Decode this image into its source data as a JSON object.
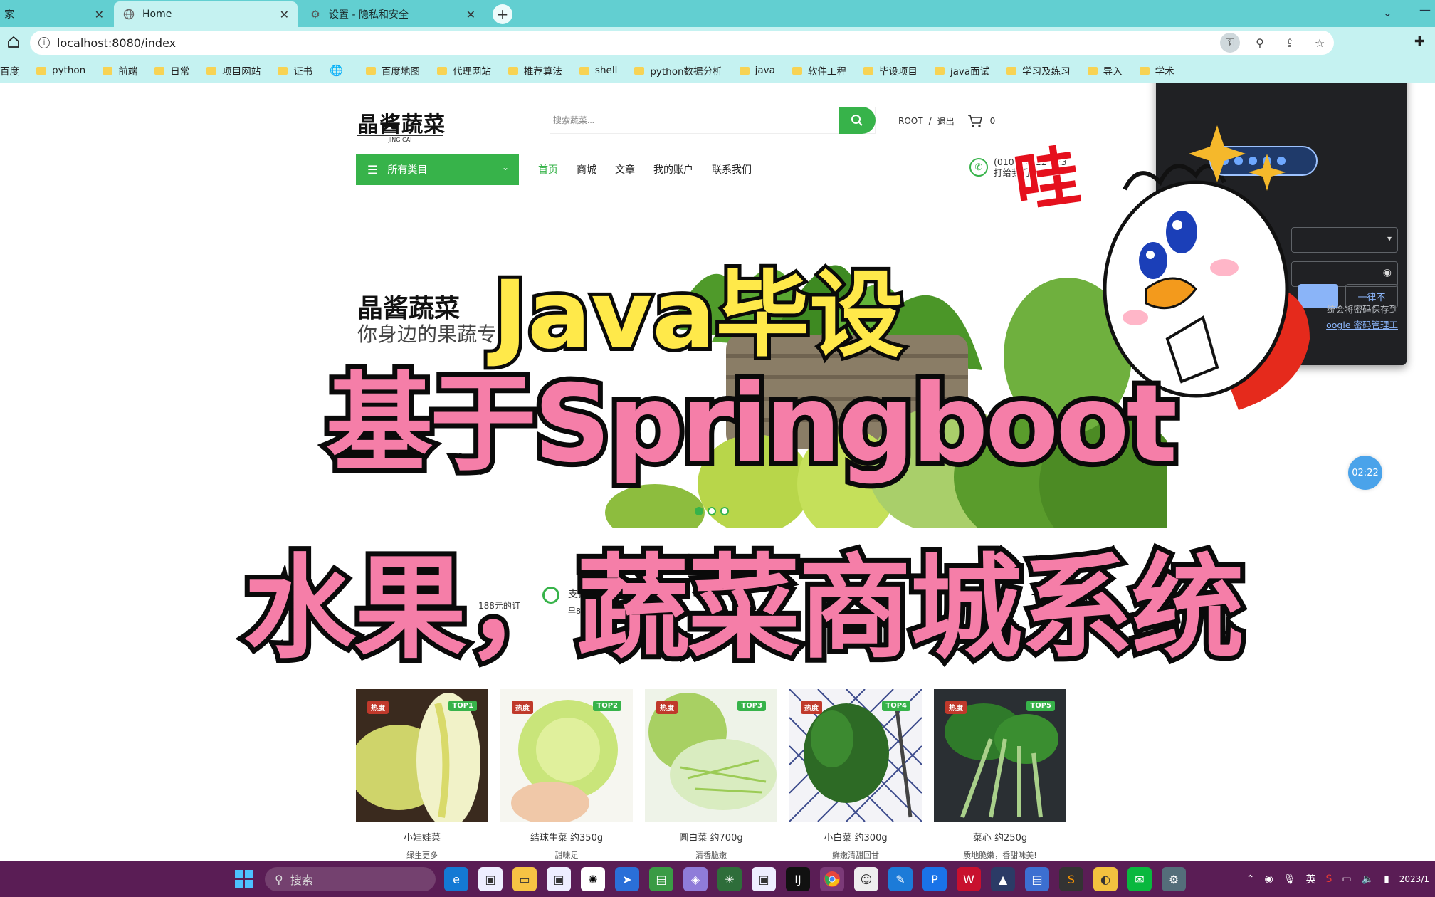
{
  "browser": {
    "tabs": [
      {
        "title": "家",
        "icon": "folder-icon",
        "active": false
      },
      {
        "title": "Home",
        "icon": "globe-icon",
        "active": true
      },
      {
        "title": "设置 - 隐私和安全",
        "icon": "gear-icon",
        "active": false
      }
    ],
    "url": "localhost:8080/index",
    "bookmarks": [
      "百度",
      "python",
      "前端",
      "日常",
      "项目网站",
      "证书",
      "",
      "百度地图",
      "代理网站",
      "推荐算法",
      "shell",
      "python数据分析",
      "java",
      "软件工程",
      "毕设项目",
      "java面试",
      "学习及练习",
      "导入",
      "学术"
    ]
  },
  "site": {
    "logo": "晶酱蔬菜",
    "logo_sub": "JING CAI",
    "search_placeholder": "搜索蔬菜...",
    "user": "ROOT",
    "separator": "/",
    "logout": "退出",
    "cart_count": "0",
    "category_button": "所有类目",
    "nav": [
      "首页",
      "商城",
      "文章",
      "我的账户",
      "联系我们"
    ],
    "phone": "(010) PG 12 123",
    "phone_sub": "打给我们?",
    "hero_title": "晶酱蔬菜",
    "hero_sub": "你身边的果蔬专家",
    "hero_slides": 3,
    "hero_active_slide": 0,
    "features": [
      {
        "text": "188元的订"
      },
      {
        "title": "支持",
        "text": "早8晚"
      }
    ],
    "products": [
      {
        "name": "小娃娃菜",
        "desc": "绿生更多",
        "hot": "热度",
        "rank": "TOP1"
      },
      {
        "name": "结球生菜 约350g",
        "desc": "甜味足",
        "hot": "热度",
        "rank": "TOP2"
      },
      {
        "name": "圆白菜 约700g",
        "desc": "清香脆嫩",
        "hot": "热度",
        "rank": "TOP3"
      },
      {
        "name": "小白菜 约300g",
        "desc": "鲜嫩清甜回甘",
        "hot": "热度",
        "rank": "TOP4"
      },
      {
        "name": "菜心 约250g",
        "desc": "质地脆嫩，香甜味美!",
        "hot": "热度",
        "rank": "TOP5"
      }
    ],
    "timer": "02:22"
  },
  "password_popup": {
    "never_button": "一律不",
    "note_line1": "统会将密码保存到",
    "note_link": "oogle 密码管理工"
  },
  "overlay": {
    "line1": "Java毕设",
    "line2": "基于Springboot",
    "line3": "水果，蔬菜商城系统",
    "exclaim": "哇"
  },
  "taskbar": {
    "search": "搜索",
    "ime": "英",
    "clock": "2023/1"
  },
  "colors": {
    "brand_green": "#37b34a",
    "tab_strip": "#62cfd1",
    "toolbar": "#c5f2f1",
    "taskbar": "#5a1d55",
    "overlay_yellow": "#ffe94a",
    "overlay_pink": "#f57ea8"
  }
}
